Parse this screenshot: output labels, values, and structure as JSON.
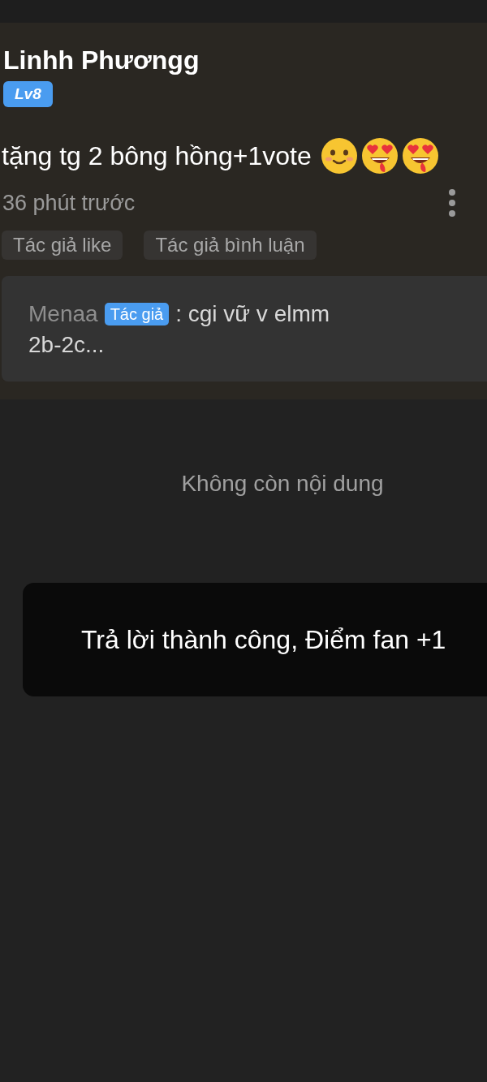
{
  "comment": {
    "author": "Linhh Phươngg",
    "level_badge": "Lv8",
    "text": "tặng tg 2 bông hồng+1vote",
    "emojis": [
      {
        "kind": "smile"
      },
      {
        "kind": "heart-eyes"
      },
      {
        "kind": "heart-eyes"
      }
    ],
    "time": "36 phút trước",
    "tags": [
      "Tác giả like",
      "Tác giả bình luận"
    ],
    "reply": {
      "author": "Menaa",
      "badge": "Tác giả",
      "text_lines": [
        ": cgi vữ v elmm",
        "2b-2c..."
      ]
    }
  },
  "end_notice": "Không còn nội dung",
  "toast": "Trả lời thành công, Điểm fan +1"
}
